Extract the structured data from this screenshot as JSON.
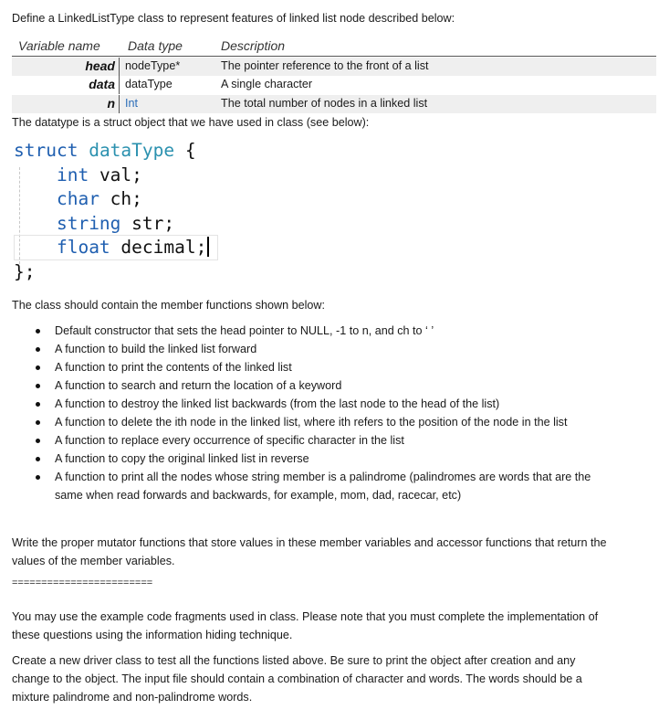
{
  "intro": "Define a LinkedListType class to represent features of linked list node described below:",
  "table": {
    "headers": [
      "Variable name",
      "Data type",
      "Description"
    ],
    "rows": [
      {
        "name": "head",
        "type": "nodeType*",
        "desc": "The pointer reference to the front of a list"
      },
      {
        "name": "data",
        "type": "dataType",
        "desc": "A single character"
      },
      {
        "name": "n",
        "type": "Int",
        "desc": "The total number of nodes in a linked list"
      }
    ]
  },
  "struct_note": "The datatype is a struct object that we have used in class (see below):",
  "code": {
    "line1_kw": "struct",
    "line1_type": "dataType",
    "line1_rest": " {",
    "line2_kw": "int",
    "line2_rest": " val;",
    "line3_kw": "char",
    "line3_rest": " ch;",
    "line4_kw": "string",
    "line4_rest": " str;",
    "line5_kw": "float",
    "line5_rest": " decimal;",
    "line6": "};"
  },
  "member_intro": "The class should contain the member functions shown below:",
  "bullets": [
    "Default constructor that sets the head pointer to NULL, -1 to n, and ch to ‘ ’",
    "A function to build the linked list forward",
    "A function to print the contents of the linked list",
    "A function to search and return the location of a keyword",
    "A function to destroy the linked list backwards (from the last node to the head of the list)",
    "A function to delete the ith node in the linked list, where ith refers to the position of the node in the list",
    "A function to replace every occurrence of specific character in the list",
    "A function to copy the original linked list in reverse",
    "A function to print all the nodes whose string member is a palindrome (palindromes are words that are the same when read forwards and backwards, for example, mom, dad, racecar, etc)"
  ],
  "mutator_para": "Write the proper mutator functions that store values in these member variables and accessor functions that return the values of the member variables.",
  "separator": "========================",
  "example_para": "You may use the example code fragments used in class. Please note that you must complete the implementation of these questions using the information hiding technique.",
  "driver_para": "Create a new driver class to test all the functions listed above. Be sure to print the object after creation and any change to the object.  The input file should contain a combination of character and words. The words should be a mixture palindrome and non-palindrome words."
}
